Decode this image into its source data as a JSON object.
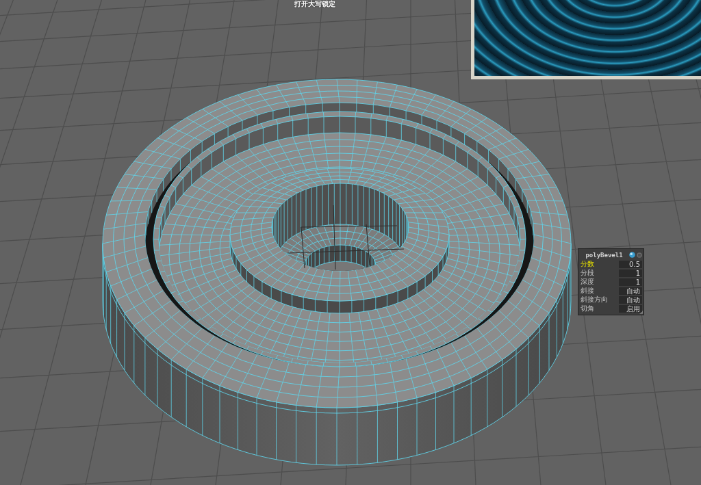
{
  "viewport": {
    "message": "打开大写锁定"
  },
  "node_panel": {
    "title": "polyBevel1",
    "attributes": [
      {
        "label": "分数",
        "value": "0.5",
        "selected": true
      },
      {
        "label": "分段",
        "value": "1",
        "selected": false
      },
      {
        "label": "深度",
        "value": "1",
        "selected": false
      },
      {
        "label": "斜接",
        "value": "自动",
        "selected": false
      },
      {
        "label": "斜接方向",
        "value": "自动",
        "selected": false
      },
      {
        "label": "切角",
        "value": "启用",
        "selected": false
      }
    ]
  }
}
